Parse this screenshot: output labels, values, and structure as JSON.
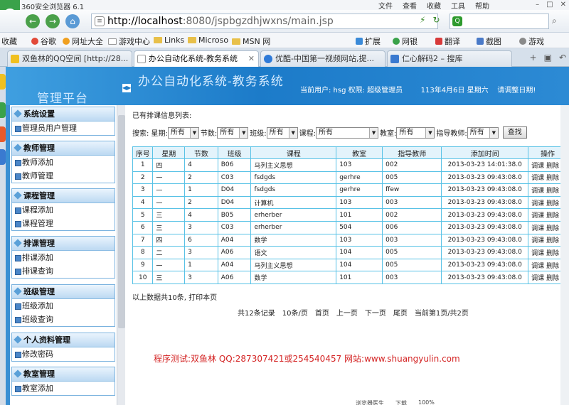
{
  "browser": {
    "title": "360安全浏览器 6.1",
    "menus": [
      "文件",
      "查看",
      "收藏",
      "工具",
      "帮助"
    ],
    "url_host": "http://localhost",
    "url_rest": ":8080/jspbgzdhjwxns/main.jsp",
    "search_placeholder": ""
  },
  "bookmarks": [
    {
      "label": "收藏"
    },
    {
      "label": "谷歌"
    },
    {
      "label": "网址大全"
    },
    {
      "label": "游戏中心"
    },
    {
      "label": "Links"
    },
    {
      "label": "Microso"
    },
    {
      "label": "MSN 网"
    },
    {
      "label": "扩展"
    },
    {
      "label": "网银"
    },
    {
      "label": "翻译"
    },
    {
      "label": "截图"
    },
    {
      "label": "游戏"
    }
  ],
  "tabs": [
    {
      "label": "双鱼林的QQ空间 [http://28..."
    },
    {
      "label": "办公自动化系统-教务系统"
    },
    {
      "label": "优酷-中国第一视频网站,提..."
    },
    {
      "label": "仁心解码2 – 搜库"
    }
  ],
  "header": {
    "platform": "管理平台",
    "system_title": "办公自动化系统-教务系统",
    "user_info": "当前用户: hsg  权限: 超级管理员",
    "date": "113年4月6日 星期六",
    "date_hint": "请调整日期!"
  },
  "sidebar": {
    "groups": [
      {
        "title": "系统设置",
        "items": [
          "管理员用户管理"
        ]
      },
      {
        "title": "教师管理",
        "items": [
          "教师添加",
          "教师管理"
        ]
      },
      {
        "title": "课程管理",
        "items": [
          "课程添加",
          "课程管理"
        ]
      },
      {
        "title": "排课管理",
        "items": [
          "排课添加",
          "排课查询"
        ]
      },
      {
        "title": "班级管理",
        "items": [
          "班级添加",
          "班级查询"
        ]
      },
      {
        "title": "个人资料管理",
        "items": [
          "修改密码"
        ]
      },
      {
        "title": "教室管理",
        "items": [
          "教室添加"
        ]
      }
    ]
  },
  "main": {
    "list_title": "已有排课信息列表:",
    "search": {
      "label": "搜索: 星期:",
      "weekday": "所有",
      "period_label": "节数:",
      "period": "所有",
      "class_label": "班级:",
      "class": "所有",
      "course_label": "课程:",
      "course": "所有",
      "room_label": "教室:",
      "room": "所有",
      "teacher_label": "指导教师:",
      "teacher": "所有",
      "button": "查找"
    },
    "columns": [
      "序号",
      "星期",
      "节数",
      "班级",
      "课程",
      "教室",
      "指导教师",
      "添加时间",
      "操作"
    ],
    "rows": [
      [
        "1",
        "四",
        "4",
        "B06",
        "马列主义思想",
        "103",
        "002",
        "2013-03-23 14:01:38.0"
      ],
      [
        "2",
        "一",
        "2",
        "C03",
        "fsdgds",
        "gerhre",
        "005",
        "2013-03-23 09:43:08.0"
      ],
      [
        "3",
        "一",
        "1",
        "D04",
        "fsdgds",
        "gerhre",
        "ffew",
        "2013-03-23 09:43:08.0"
      ],
      [
        "4",
        "一",
        "2",
        "D04",
        "计算机",
        "103",
        "003",
        "2013-03-23 09:43:08.0"
      ],
      [
        "5",
        "三",
        "4",
        "B05",
        "erherber",
        "101",
        "002",
        "2013-03-23 09:43:08.0"
      ],
      [
        "6",
        "三",
        "3",
        "C03",
        "erherber",
        "504",
        "006",
        "2013-03-23 09:43:08.0"
      ],
      [
        "7",
        "四",
        "6",
        "A04",
        "数学",
        "103",
        "003",
        "2013-03-23 09:43:08.0"
      ],
      [
        "8",
        "二",
        "3",
        "A06",
        "语文",
        "104",
        "005",
        "2013-03-23 09:43:08.0"
      ],
      [
        "9",
        "一",
        "1",
        "A04",
        "马列主义思想",
        "104",
        "005",
        "2013-03-23 09:43:08.0"
      ],
      [
        "10",
        "三",
        "3",
        "A06",
        "数学",
        "101",
        "003",
        "2013-03-23 09:43:08.0"
      ]
    ],
    "action_edit": "调课",
    "action_delete": "删除",
    "summary": "以上数据共10条, 打印本页",
    "pager": [
      "共12条记录",
      "10条/页",
      "首页",
      "上一页",
      "下一页",
      "尾页",
      "当前第1页/共2页"
    ],
    "test_info": "程序测试:双鱼林 QQ:287307421或254540457 网站:www.shuangyulin.com"
  },
  "status": {
    "left": "浏览器医生",
    "download": "下载",
    "zoom": "100%"
  }
}
